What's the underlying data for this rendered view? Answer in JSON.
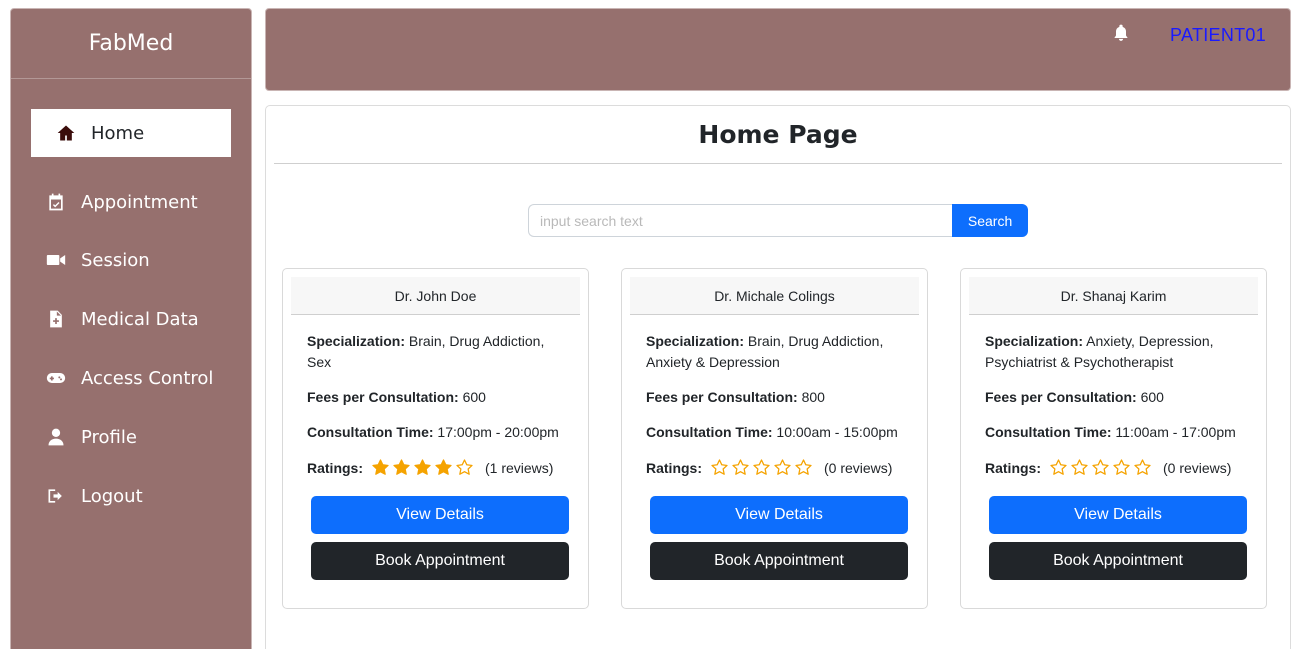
{
  "brand": "FabMed",
  "sidebar": {
    "items": [
      {
        "label": "Home",
        "icon": "home-icon",
        "active": true
      },
      {
        "label": "Appointment",
        "icon": "calendar-check-icon"
      },
      {
        "label": "Session",
        "icon": "video-camera-icon"
      },
      {
        "label": "Medical Data",
        "icon": "file-medical-icon"
      },
      {
        "label": "Access Control",
        "icon": "gamepad-icon"
      },
      {
        "label": "Profile",
        "icon": "user-icon"
      },
      {
        "label": "Logout",
        "icon": "logout-icon"
      }
    ]
  },
  "topbar": {
    "notification_icon": "bell-icon",
    "username": "PATIENT01"
  },
  "page": {
    "title": "Home Page"
  },
  "search": {
    "placeholder": "input search text",
    "value": "",
    "button_label": "Search"
  },
  "labels": {
    "specialization": "Specialization:",
    "fees": "Fees per Consultation:",
    "time": "Consultation Time:",
    "ratings": "Ratings:",
    "view_details": "View Details",
    "book_appointment": "Book Appointment"
  },
  "colors": {
    "sidebar_bg": "#96706e",
    "primary": "#0d6efd",
    "dark": "#212529",
    "star": "#f5a300",
    "username": "#1a1aff"
  },
  "doctors": [
    {
      "name": "Dr. John Doe",
      "specialization": "Brain, Drug Addiction, Sex",
      "fees": "600",
      "time": "17:00pm - 20:00pm",
      "rating": 4,
      "max_rating": 5,
      "reviews": "(1 reviews)"
    },
    {
      "name": "Dr. Michale Colings",
      "specialization": "Brain, Drug Addiction, Anxiety & Depression",
      "fees": "800",
      "time": "10:00am - 15:00pm",
      "rating": 0,
      "max_rating": 5,
      "reviews": "(0 reviews)"
    },
    {
      "name": "Dr. Shanaj Karim",
      "specialization": "Anxiety, Depression, Psychiatrist & Psychotherapist",
      "fees": "600",
      "time": "11:00am - 17:00pm",
      "rating": 0,
      "max_rating": 5,
      "reviews": "(0 reviews)"
    }
  ]
}
